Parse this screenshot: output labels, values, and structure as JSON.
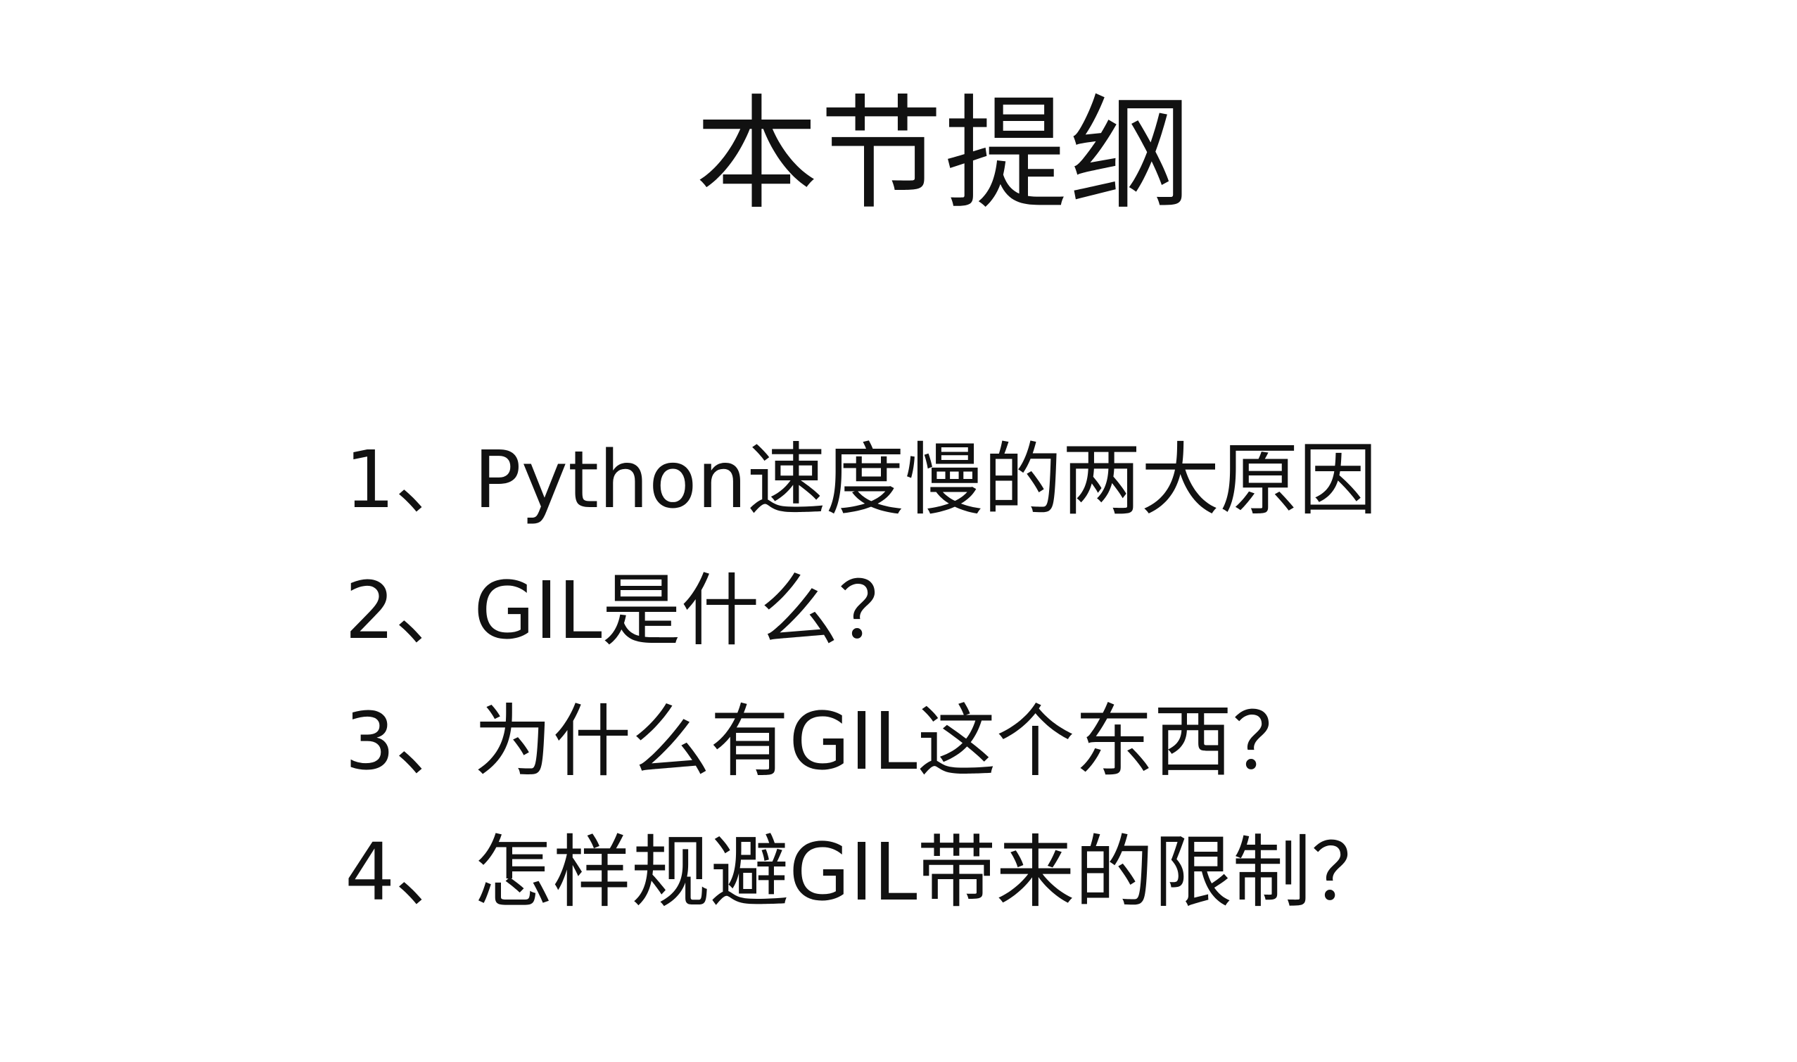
{
  "slide": {
    "title": "本节提纲",
    "outline_items": [
      "1、Python速度慢的两大原因",
      "2、GIL是什么？",
      "3、为什么有GIL这个东西？",
      "4、怎样规避GIL带来的限制？"
    ]
  }
}
